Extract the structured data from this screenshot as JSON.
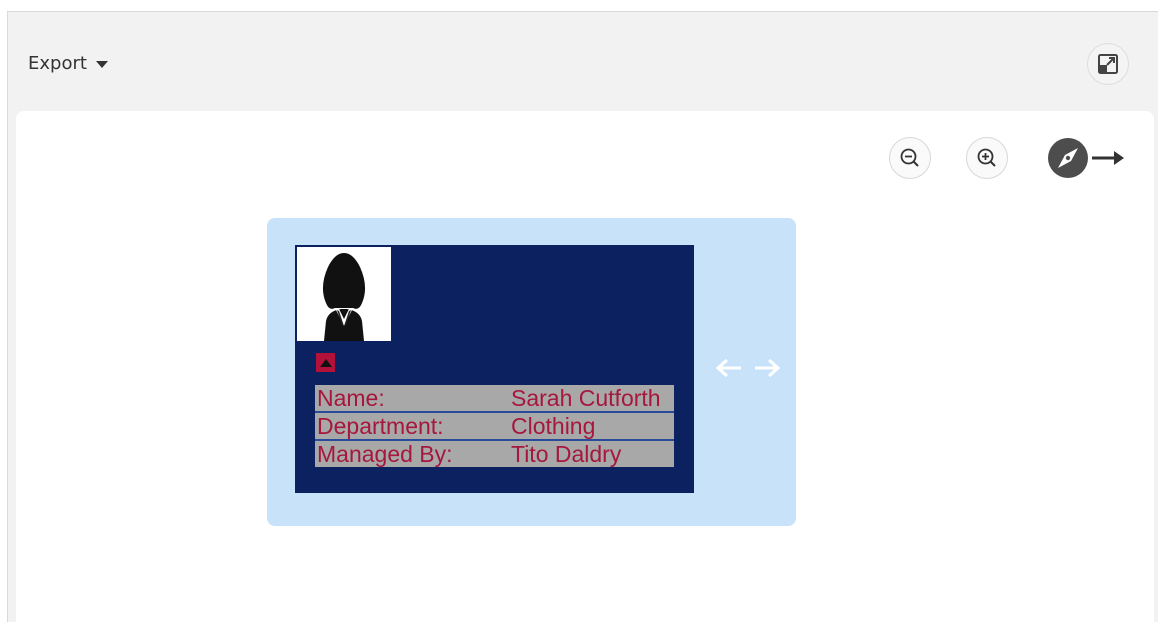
{
  "toolbar": {
    "export_label": "Export",
    "export_caret": "caret-down-icon",
    "fullscreen_icon": "fullscreen-icon"
  },
  "controls": {
    "zoom_out_icon": "zoom-out-icon",
    "zoom_in_icon": "zoom-in-icon",
    "navigate_icon": "compass-arrow-icon"
  },
  "node": {
    "photo_icon": "female-avatar-icon",
    "collapse_icon": "collapse-up-icon",
    "fields": [
      {
        "key": "Name:",
        "value": "Sarah Cutforth"
      },
      {
        "key": "Department:",
        "value": "Clothing"
      },
      {
        "key": "Managed By:",
        "value": "Tito Daldry"
      }
    ],
    "move_icons": [
      "arrow-left-icon",
      "arrow-right-icon"
    ]
  },
  "colors": {
    "node_background": "#0c2260",
    "node_highlight": "#c7e2f9",
    "field_text": "#a6173e",
    "field_background": "#a8a8a8",
    "collapse_button": "#b4113a"
  }
}
